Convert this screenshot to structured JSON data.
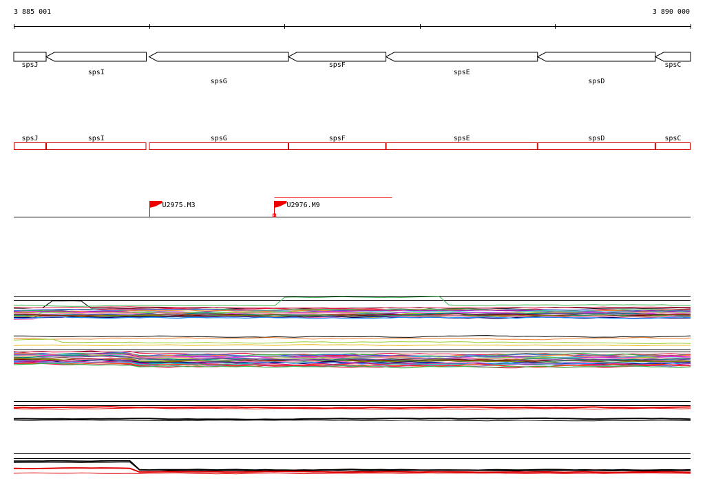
{
  "ruler": {
    "start_label": "3 885 001",
    "end_label": "3 890 000",
    "start": 3885001,
    "end": 3890000
  },
  "genes": [
    {
      "name": "spsJ",
      "start": 3885001,
      "end": 3885240,
      "strand": "+"
    },
    {
      "name": "spsI",
      "start": 3885240,
      "end": 3885980,
      "strand": "-"
    },
    {
      "name": "spsG",
      "start": 3886000,
      "end": 3887030,
      "strand": "-"
    },
    {
      "name": "spsF",
      "start": 3887030,
      "end": 3887750,
      "strand": "-"
    },
    {
      "name": "spsE",
      "start": 3887750,
      "end": 3888870,
      "strand": "-"
    },
    {
      "name": "spsD",
      "start": 3888870,
      "end": 3889740,
      "strand": "-"
    },
    {
      "name": "spsC",
      "start": 3889740,
      "end": 3890000,
      "strand": "-"
    }
  ],
  "markers": [
    {
      "name": "U2975.M3",
      "position": 3886005
    },
    {
      "name": "U2976.M9",
      "position": 3886925,
      "span_end": 3887795
    }
  ],
  "track_colors": {
    "gene_outline": "#000000",
    "gene_box_outline": "#cc0000",
    "marker_flag": "#ee0000"
  }
}
